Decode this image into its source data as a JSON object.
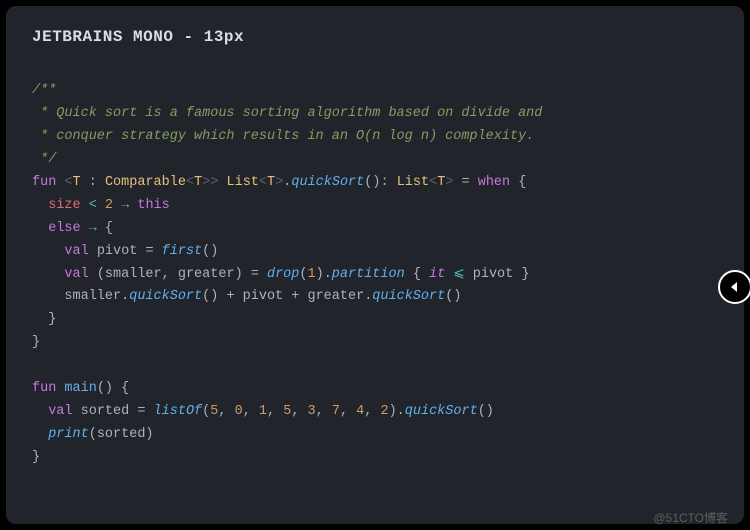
{
  "header": {
    "title": "JETBRAINS MONO - 13px"
  },
  "comment": {
    "l1": "/**",
    "l2": " * Quick sort is a famous sorting algorithm based on divide and",
    "l3": " * conquer strategy which results in an O(n log n) complexity.",
    "l4": " */"
  },
  "kw": {
    "fun": "fun",
    "val": "val",
    "when": "when",
    "this": "this",
    "else": "else",
    "it": "it"
  },
  "sig": {
    "lt": "<",
    "gt": ">",
    "T": "T",
    "colon": " : ",
    "Comparable": "Comparable",
    "gtgt": ">>",
    "space": " ",
    "List": "List",
    "dot": ".",
    "quickSort": "quickSort",
    "parenOpen": "(",
    "parenClose": ")",
    "retColon": ": ",
    "eq": " = ",
    "braceOpen": " {",
    "braceClose": "}"
  },
  "body": {
    "size": "size",
    "ltOp": " < ",
    "two": "2",
    "arrow": " → ",
    "pivot": "pivot",
    "eq": " = ",
    "first": "first",
    "smaller": "smaller",
    "greater": "greater",
    "tupleOpen": " (",
    "comma": ", ",
    "tupleClose": ") ",
    "drop": "drop",
    "one": "1",
    "partition": "partition",
    "lbrace": " { ",
    "rbrace": " }",
    "le": " ⩽ ",
    "plus": " + ",
    "smallerDot": "smaller.",
    "greaterDot": "greater."
  },
  "main": {
    "main": "main",
    "sorted": "sorted",
    "listOf": "listOf",
    "nums": {
      "n0": "5",
      "n1": "0",
      "n2": "1",
      "n3": "5",
      "n4": "3",
      "n5": "7",
      "n6": "4",
      "n7": "2"
    },
    "print": "print",
    "sortedArg": "(sorted)"
  },
  "watermark": "@51CTO博客",
  "sideButton": {
    "name": "collapse-left"
  }
}
